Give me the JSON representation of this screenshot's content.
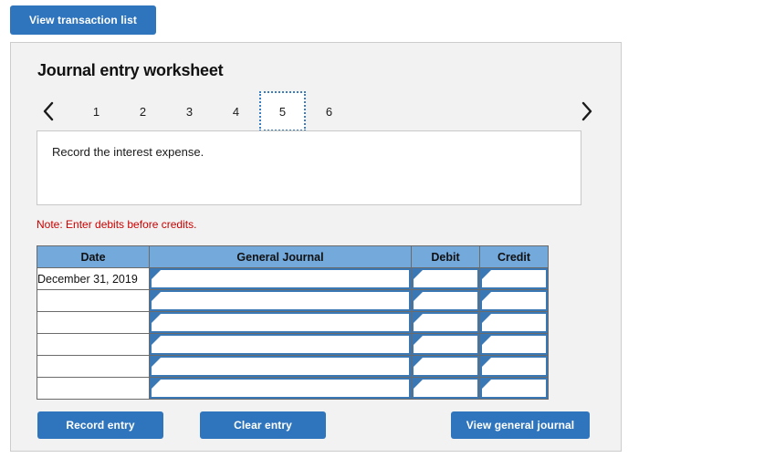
{
  "top": {
    "view_transaction_list_label": "View transaction list"
  },
  "panel": {
    "title": "Journal entry worksheet",
    "pager": {
      "prev_icon": "chevron-left-icon",
      "next_icon": "chevron-right-icon",
      "tabs": [
        {
          "label": "1",
          "selected": false
        },
        {
          "label": "2",
          "selected": false
        },
        {
          "label": "3",
          "selected": false
        },
        {
          "label": "4",
          "selected": false
        },
        {
          "label": "5",
          "selected": true
        },
        {
          "label": "6",
          "selected": false
        }
      ],
      "selected_tab": "5"
    },
    "instruction": "Record the interest expense.",
    "note": "Note: Enter debits before credits.",
    "table": {
      "columns": [
        "Date",
        "General Journal",
        "Debit",
        "Credit"
      ],
      "rows": [
        {
          "date": "December 31, 2019",
          "general_journal": "",
          "debit": "",
          "credit": ""
        },
        {
          "date": "",
          "general_journal": "",
          "debit": "",
          "credit": ""
        },
        {
          "date": "",
          "general_journal": "",
          "debit": "",
          "credit": ""
        },
        {
          "date": "",
          "general_journal": "",
          "debit": "",
          "credit": ""
        },
        {
          "date": "",
          "general_journal": "",
          "debit": "",
          "credit": ""
        },
        {
          "date": "",
          "general_journal": "",
          "debit": "",
          "credit": ""
        }
      ]
    },
    "actions": {
      "record_entry_label": "Record entry",
      "clear_entry_label": "Clear entry",
      "view_general_journal_label": "View general journal"
    }
  },
  "colors": {
    "button_blue": "#2f75bd",
    "header_blue": "#74a9dc",
    "note_red": "#cc0000",
    "panel_gray": "#f2f2f2",
    "input_border_blue": "#3a78b5",
    "tab_selected_border": "#3a7ebf"
  }
}
